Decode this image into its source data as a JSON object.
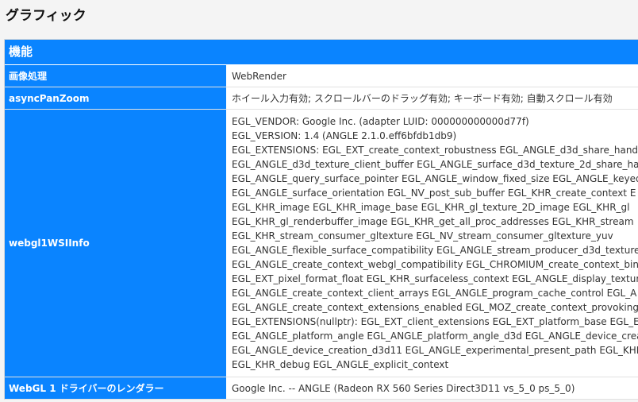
{
  "page": {
    "title": "グラフィック"
  },
  "section": {
    "title": "機能"
  },
  "rows": [
    {
      "key": "画像処理",
      "value": "WebRender"
    },
    {
      "key": "asyncPanZoom",
      "value": "ホイール入力有効; スクロールバーのドラッグ有効; キーボード有効; 自動スクロール有効"
    },
    {
      "key": "webgl1WSIInfo",
      "lines": [
        "EGL_VENDOR: Google Inc. (adapter LUID: 000000000000d77f)",
        "EGL_VERSION: 1.4 (ANGLE 2.1.0.eff6bfdb1db9)",
        "EGL_EXTENSIONS: EGL_EXT_create_context_robustness EGL_ANGLE_d3d_share_hand",
        "EGL_ANGLE_d3d_texture_client_buffer EGL_ANGLE_surface_d3d_texture_2d_share_ha",
        "EGL_ANGLE_query_surface_pointer EGL_ANGLE_window_fixed_size EGL_ANGLE_keyed",
        "EGL_ANGLE_surface_orientation EGL_NV_post_sub_buffer EGL_KHR_create_context E",
        "EGL_KHR_image EGL_KHR_image_base EGL_KHR_gl_texture_2D_image EGL_KHR_gl",
        "EGL_KHR_gl_renderbuffer_image EGL_KHR_get_all_proc_addresses EGL_KHR_stream",
        "EGL_KHR_stream_consumer_gltexture EGL_NV_stream_consumer_gltexture_yuv",
        "EGL_ANGLE_flexible_surface_compatibility EGL_ANGLE_stream_producer_d3d_texture",
        "EGL_ANGLE_create_context_webgl_compatibility EGL_CHROMIUM_create_context_bind",
        "EGL_EXT_pixel_format_float EGL_KHR_surfaceless_context EGL_ANGLE_display_textur",
        "EGL_ANGLE_create_context_client_arrays EGL_ANGLE_program_cache_control EGL_A",
        "EGL_ANGLE_create_context_extensions_enabled EGL_MOZ_create_context_provoking_",
        "EGL_EXTENSIONS(nullptr): EGL_EXT_client_extensions EGL_EXT_platform_base EGL_E",
        "EGL_ANGLE_platform_angle EGL_ANGLE_platform_angle_d3d EGL_ANGLE_device_crea",
        "EGL_ANGLE_device_creation_d3d11 EGL_ANGLE_experimental_present_path EGL_KHR",
        "EGL_KHR_debug EGL_ANGLE_explicit_context"
      ]
    },
    {
      "key": "WebGL 1 ドライバーのレンダラー",
      "value": "Google Inc. -- ANGLE (Radeon RX 560 Series Direct3D11 vs_5_0 ps_5_0)"
    }
  ]
}
